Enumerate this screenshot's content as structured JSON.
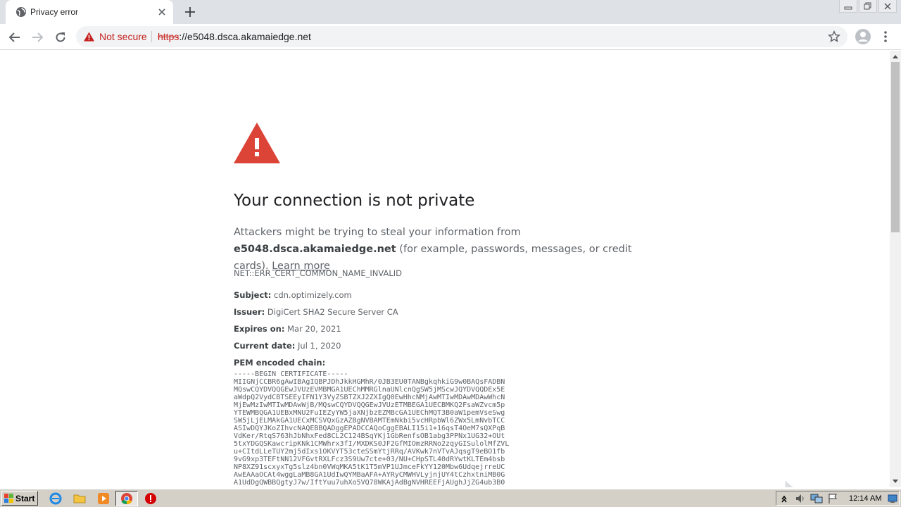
{
  "browser": {
    "tab": {
      "title": "Privacy error",
      "favicon": "globe-icon"
    },
    "omnibox": {
      "security_label": "Not secure",
      "url_scheme": "https",
      "url_rest": "://e5048.dsca.akamaiedge.net"
    }
  },
  "page": {
    "heading": "Your connection is not private",
    "desc_before": "Attackers might be trying to steal your information from ",
    "desc_host": "e5048.dsca.akamaiedge.net",
    "desc_after": " (for example, passwords, messages, or credit cards). ",
    "learn_more": "Learn more",
    "error_code": "NET::ERR_CERT_COMMON_NAME_INVALID",
    "details": [
      {
        "label": "Subject:",
        "value": "cdn.optimizely.com"
      },
      {
        "label": "Issuer:",
        "value": "DigiCert SHA2 Secure Server CA"
      },
      {
        "label": "Expires on:",
        "value": "Mar 20, 2021"
      },
      {
        "label": "Current date:",
        "value": "Jul 1, 2020"
      },
      {
        "label": "PEM encoded chain:",
        "value": ""
      }
    ],
    "pem_lines": [
      "-----BEGIN CERTIFICATE-----",
      "MIIGNjCCBR6gAwIBAgIQBPJDhJkkHGMhR/0JB3EU0TANBgkqhkiG9w0BAQsFADBN",
      "MQswCQYDVQQGEwJVUzEVMBMGA1UEChMMRGlnaUNlcnQgSW5jMScwJQYDVQQDEx5E",
      "aWdpQ2VydCBTSEEyIFN1Y3VyZSBTZXJ2ZXIgQ0EwHhcNMjAwMTIwMDAwMDAwWhcN",
      "MjEwMzIwMTIwMDAwWjB/MQswCQYDVQQGEwJVUzETMBEGA1UECBMKQ2FsaWZvcm5p",
      "YTEWMBQGA1UEBxMNU2FuIEZyYW5jaXNjbzEZMBcGA1UEChMQT3B0aW1pemVseSwg",
      "SW5jLjELMAkGA1UECxMCSVQxGzAZBgNVBAMTEmNkbi5vcHRpbWl6ZWx5LmNvbTCC",
      "ASIwDQYJKoZIhvcNAQEBBQADggEPADCCAQoCggEBALI15i1+16qsT4OeM7sQXPqB",
      "VdKer/RtqS763hJbNhxFed8CL2C124BSqYKj1GbRenfsOB1abg3PPNx1UG32+OUt",
      "5txYDGQSKawcripKNk1CMWhrx3fI/MXDKS0JF2GfMIOmzRRNo2zqyGISulolMfZVL",
      "u+CItdLLeTUY2mj5dIxs1OKVYT53cteSSmYtjRRq/AVKwk7nVTvAJqsgT9eBO1fb",
      "9vG9xp3TEFtNN12VFGvtRXLFcz3S9Uw7cte+03/NU+CHpSTL40dRYwtKLTEm4bsb",
      "NP8XZ91scxyxTg5slz4bn0VWqMKA5tK1T5mVP1UJmceFkYY120Mbw6UdqejrreUC",
      "AwEAAaOCAt4wggLaMB8GA1UdIwQYMBaAFA+AYRyCMWHVLyjnjUY4tCzhxtniMB0G",
      "A1UdDgQWBBQgtyJ7w/IftYuu7uhXo5VQ78WKAjAdBgNVHREEFjAUghJjZG4ub3B0"
    ]
  },
  "taskbar": {
    "start_label": "Start",
    "clock": "12:14 AM"
  }
}
